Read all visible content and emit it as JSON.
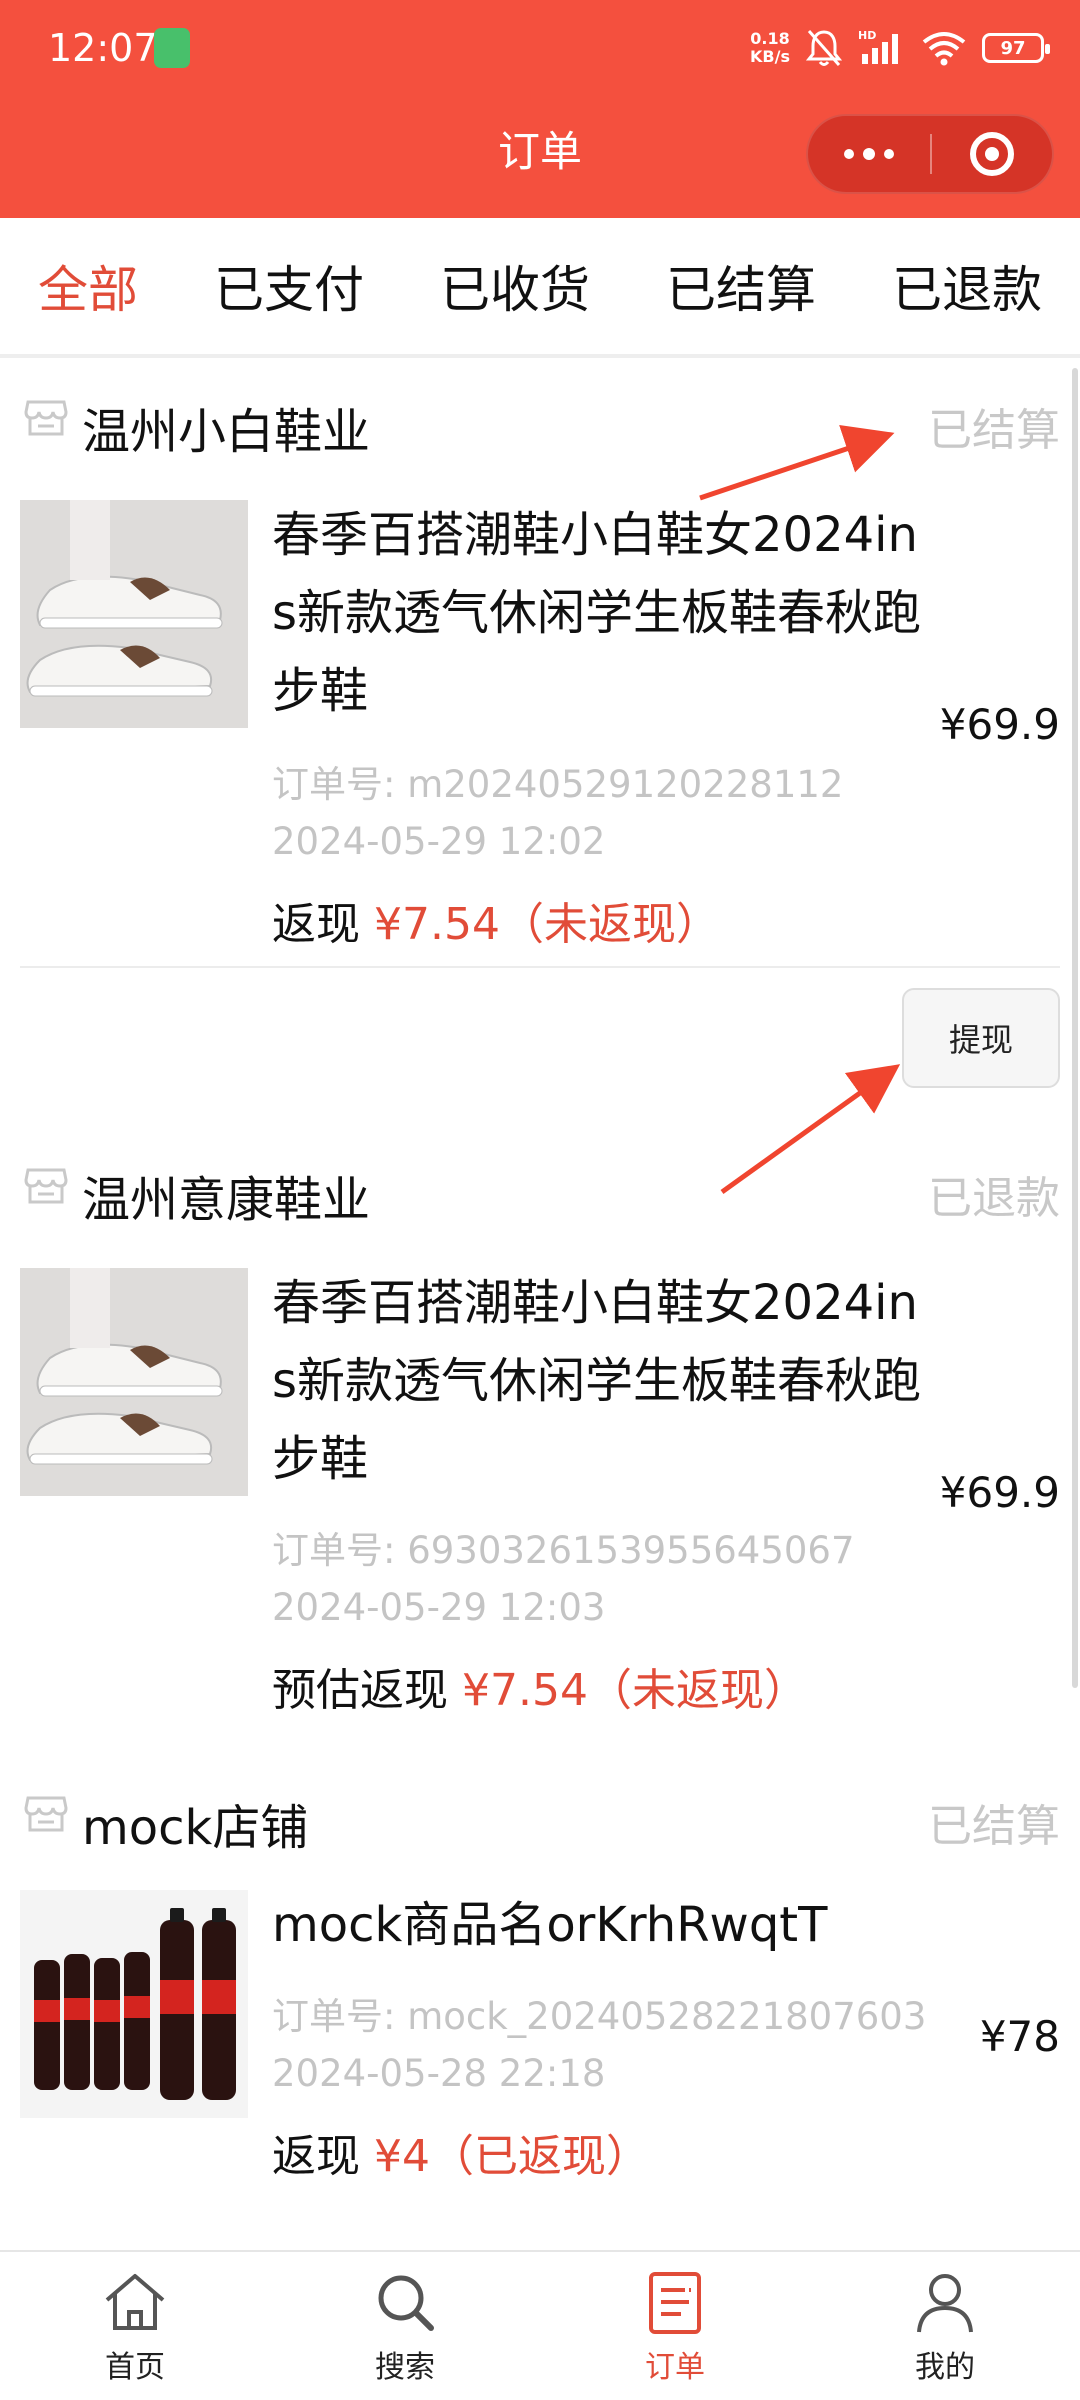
{
  "status_bar": {
    "time": "12:07",
    "net_speed_value": "0.18",
    "net_speed_unit": "KB/s",
    "battery": "97"
  },
  "header": {
    "title": "订单"
  },
  "tabs": [
    {
      "label": "全部",
      "active": true
    },
    {
      "label": "已支付",
      "active": false
    },
    {
      "label": "已收货",
      "active": false
    },
    {
      "label": "已结算",
      "active": false
    },
    {
      "label": "已退款",
      "active": false
    }
  ],
  "orders": [
    {
      "shop": "温州小白鞋业",
      "status": "已结算",
      "title": "春季百搭潮鞋小白鞋女2024ins新款透气休闲学生板鞋春秋跑步鞋",
      "price": "¥69.9",
      "order_no": "订单号: m20240529120228112",
      "time": "2024-05-29 12:02",
      "cash_label": "返现",
      "cash_amount": "¥7.54（未返现）"
    },
    {
      "shop": "温州意康鞋业",
      "status": "已退款",
      "title": "春季百搭潮鞋小白鞋女2024ins新款透气休闲学生板鞋春秋跑步鞋",
      "price": "¥69.9",
      "order_no": "订单号: 6930326153955645067",
      "time": "2024-05-29 12:03",
      "cash_label": "预估返现",
      "cash_amount": "¥7.54（未返现）"
    },
    {
      "shop": "mock店铺",
      "status": "已结算",
      "title": "mock商品名orKrhRwqtT",
      "price": "¥78",
      "order_no": "订单号: mock_20240528221807603",
      "time": "2024-05-28 22:18",
      "cash_label": "返现",
      "cash_amount": "¥4（已返现）"
    }
  ],
  "withdraw_button": "提现",
  "bottom_nav": [
    {
      "label": "首页",
      "icon": "home-icon"
    },
    {
      "label": "搜索",
      "icon": "search-icon"
    },
    {
      "label": "订单",
      "icon": "order-icon",
      "active": true
    },
    {
      "label": "我的",
      "icon": "profile-icon"
    }
  ],
  "colors": {
    "brand": "#f4503e",
    "accent_text": "#e14c38",
    "muted": "#c4c4c4"
  }
}
